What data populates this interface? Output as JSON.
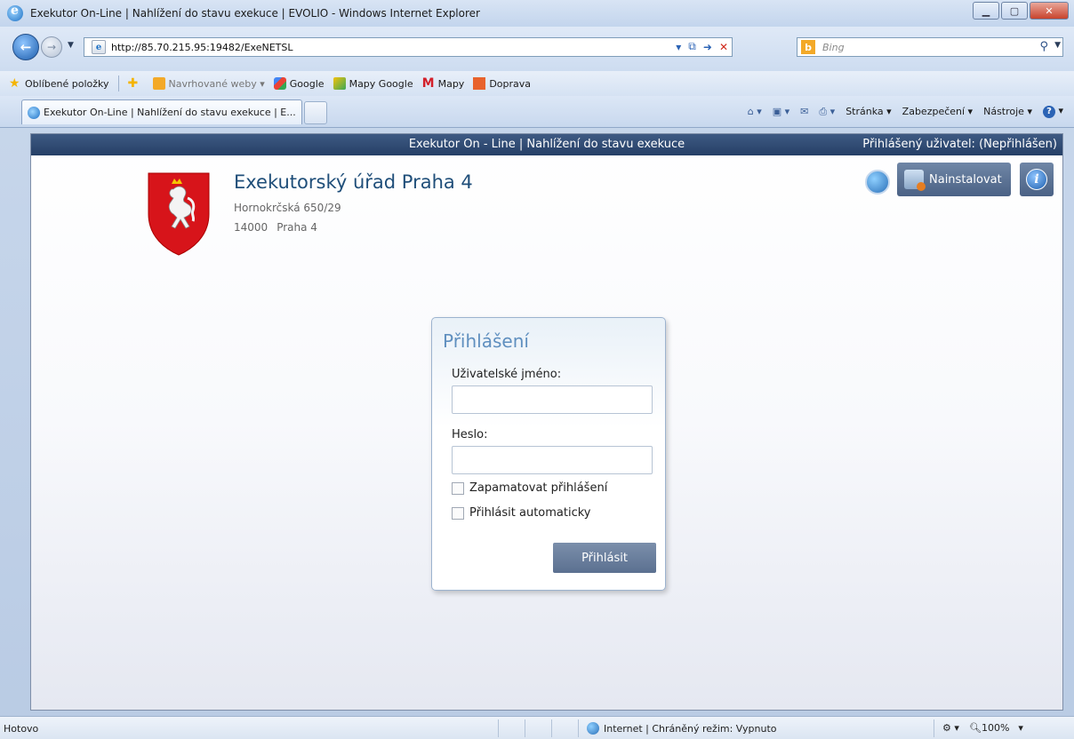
{
  "window": {
    "title": "Exekutor On-Line | Nahlížení do stavu exekuce | EVOLIO - Windows Internet Explorer"
  },
  "navigation": {
    "url": "http://85.70.215.95:19482/ExeNETSL",
    "search_placeholder": "Bing"
  },
  "favorites": {
    "label": "Oblíbené položky",
    "items": [
      {
        "label": "Navrhované weby ▾",
        "icon": "web-slice-icon"
      },
      {
        "label": "Google",
        "icon": "google-icon"
      },
      {
        "label": "Mapy Google",
        "icon": "maps-google-icon"
      },
      {
        "label": "Mapy",
        "icon": "mapy-icon"
      },
      {
        "label": "Doprava",
        "icon": "doprava-icon"
      }
    ]
  },
  "tab": {
    "title": "Exekutor On-Line | Nahlížení do stavu exekuce | E..."
  },
  "commandbar": {
    "page": "Stránka ▾",
    "security": "Zabezpečení ▾",
    "tools": "Nástroje ▾"
  },
  "app": {
    "header_title": "Exekutor On - Line | Nahlížení do stavu exekuce",
    "user_label": "Přihlášený uživatel:",
    "user_value": "(Nepřihlášen)",
    "office": {
      "name": "Exekutorský úřad Praha 4",
      "street": "Hornokrčská 650/29",
      "zip": "14000",
      "city": "Praha 4"
    },
    "install_label": "Nainstalovat"
  },
  "login": {
    "title": "Přihlášení",
    "username_label": "Uživatelské jméno:",
    "username_value": "",
    "password_label": "Heslo:",
    "password_value": "",
    "remember_label": "Zapamatovat přihlášení",
    "remember_checked": false,
    "auto_label": "Přihlásit automaticky",
    "auto_checked": false,
    "submit_label": "Přihlásit"
  },
  "status": {
    "text": "Hotovo",
    "zone": "Internet | Chráněný režim: Vypnuto",
    "zoom": "100%"
  }
}
